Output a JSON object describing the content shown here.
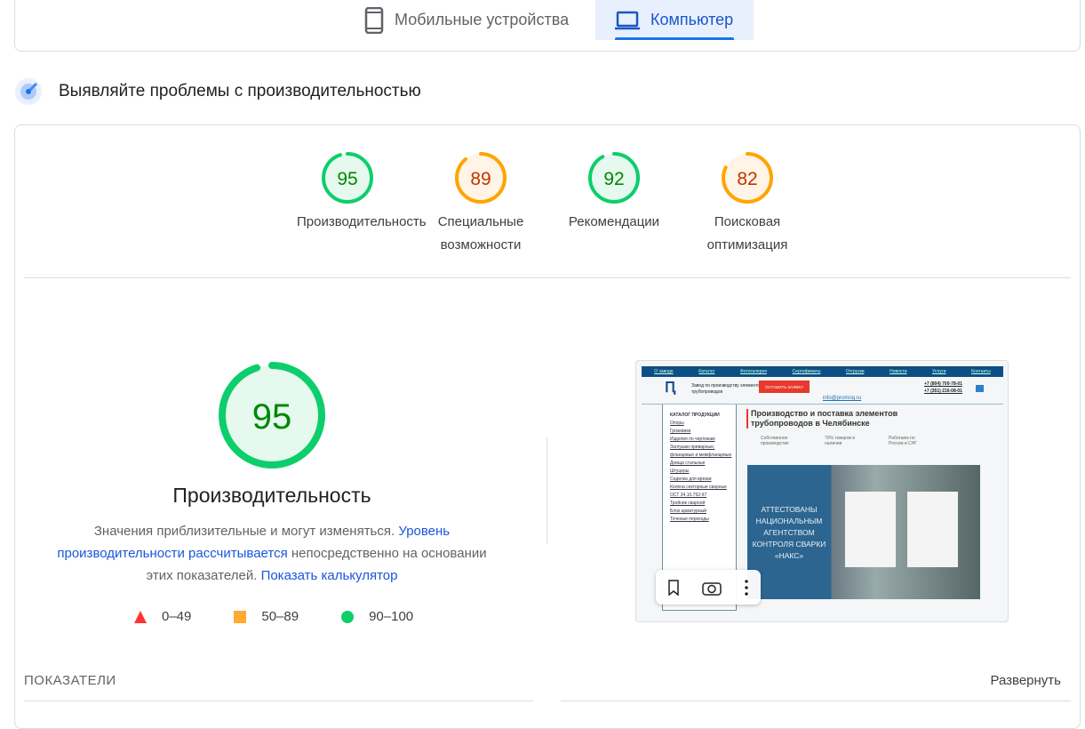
{
  "tabs": [
    {
      "label": "Мобильные устройства",
      "icon": "phone-icon"
    },
    {
      "label": "Компьютер",
      "icon": "laptop-icon"
    }
  ],
  "section_title": "Выявляйте проблемы с производительностью",
  "scores": [
    {
      "label": "Производительность",
      "value": 95,
      "color": "#0cce6b",
      "text": "#008800",
      "bg": "#e6f9ee"
    },
    {
      "label": "Специальные возможности",
      "value": 89,
      "color": "#ffa400",
      "text": "#c33300",
      "bg": "#fff4e5"
    },
    {
      "label": "Рекомендации",
      "value": 92,
      "color": "#0cce6b",
      "text": "#008800",
      "bg": "#e6f9ee"
    },
    {
      "label": "Поисковая оптимизация",
      "value": 82,
      "color": "#ffa400",
      "text": "#c33300",
      "bg": "#fff4e5"
    }
  ],
  "main": {
    "score": 95,
    "title": "Производительность",
    "desc1": "Значения приблизительные и могут изменяться. ",
    "link1": "Уровень производительности рассчитывается",
    "desc2": " непосредственно на основании этих показателей. ",
    "link2": "Показать калькулятор",
    "legend": [
      {
        "label": "0–49",
        "icon": "triangle-icon"
      },
      {
        "label": "50–89",
        "icon": "square-icon"
      },
      {
        "label": "90–100",
        "icon": "circle-icon"
      }
    ]
  },
  "screenshot": {
    "nav": [
      "О заводе",
      "Каталог",
      "Фотогалерея",
      "Сертификаты",
      "Отгрузки",
      "Новости",
      "Услуги",
      "Контакты"
    ],
    "company": "Завод по производству элементов трубопроводов",
    "cta": "ОСТАВИТЬ ЗАЯВКУ",
    "email": "info@promng.ru",
    "phones": [
      "+7 (804) 700-78-01",
      "+7 (351) 216-08-01"
    ],
    "catalog_title": "КАТАЛОГ ПРОДУКЦИИ",
    "catalog": [
      "Опоры",
      "Грязевики",
      "Изделия по чертежам",
      "Заглушки приварные, фланцевые и межфланцевые",
      "Днища стальные",
      "Штуцеры",
      "Седелка для врезки",
      "Колена секторные сварные ОСТ 34.10.752-97",
      "Тройник сварной",
      "Блок арматурный",
      "Точеные переходы"
    ],
    "headline": "Производство и поставка элементов трубопроводов в Челябинске",
    "features": [
      "Собственное производство",
      "70% товаров в наличии",
      "Работаем по России и СНГ"
    ],
    "banner": "АТТЕСТОВАНЫ НАЦИОНАЛЬНЫМ АГЕНТСТВОМ КОНТРОЛЯ СВАРКИ «НАКС»"
  },
  "metrics_label": "ПОКАЗАТЕЛИ",
  "expand_label": "Развернуть"
}
